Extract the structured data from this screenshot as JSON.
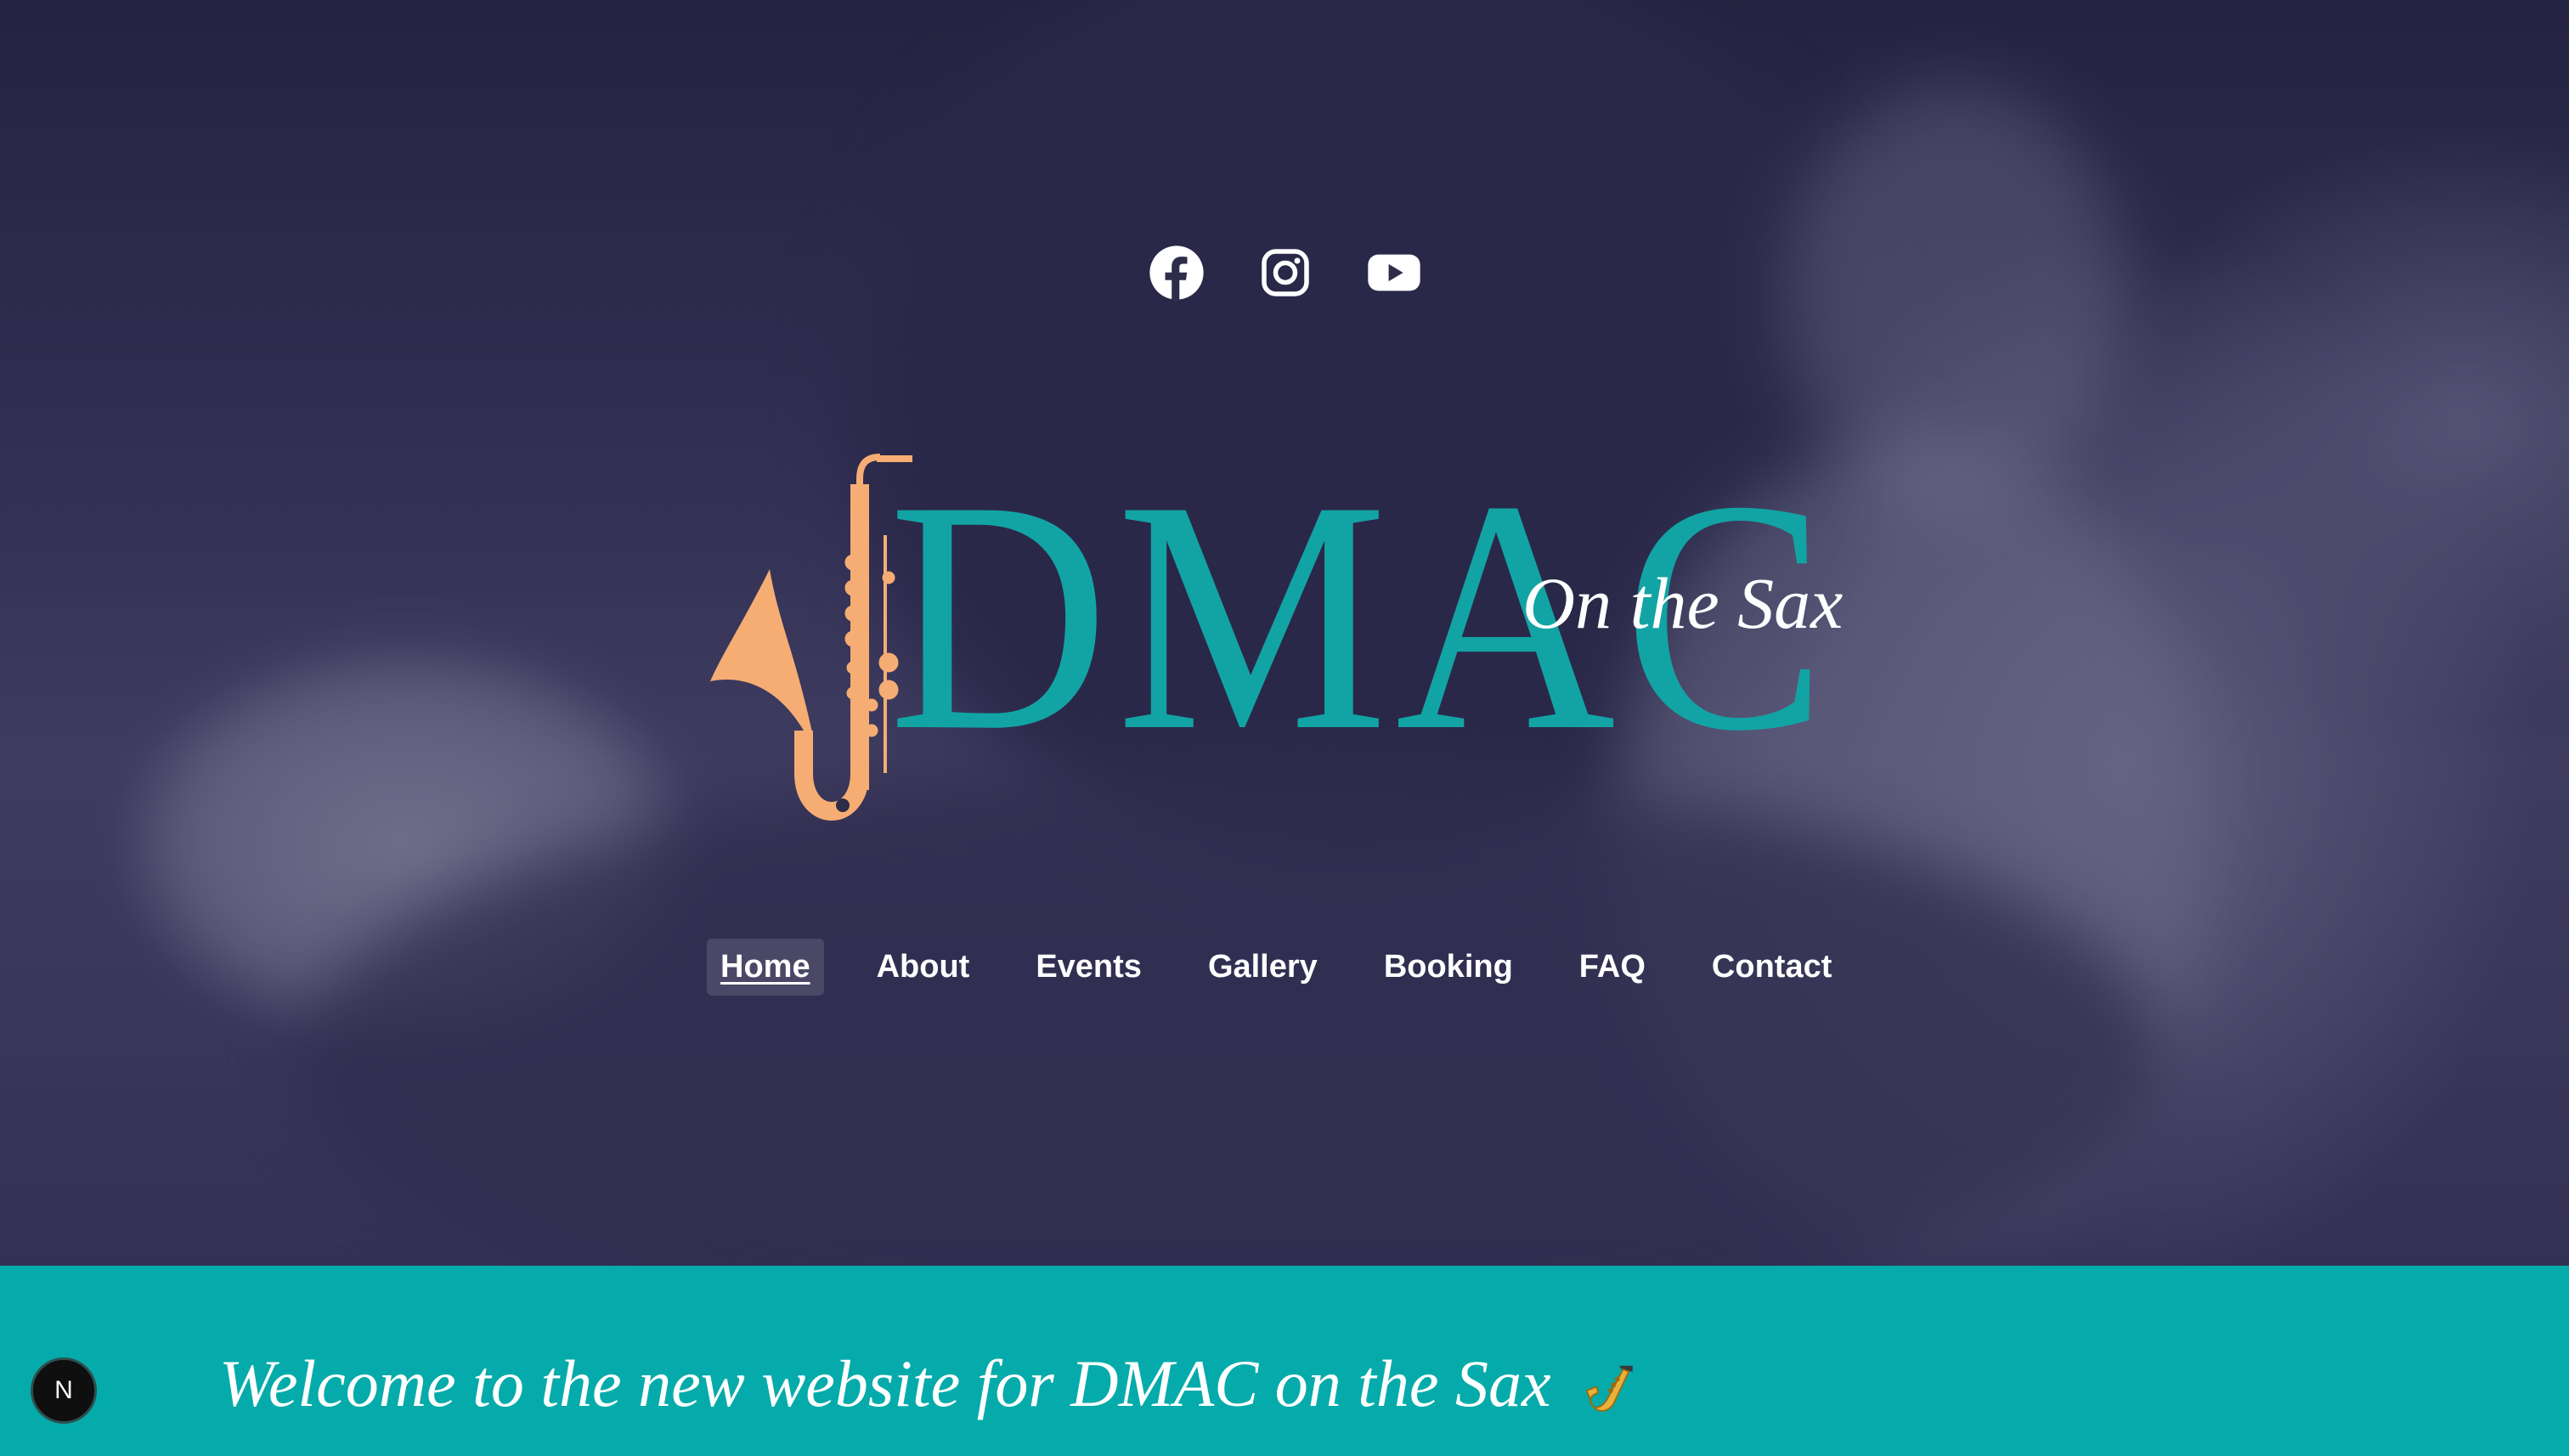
{
  "socials": [
    {
      "name": "Facebook",
      "icon": "facebook-icon"
    },
    {
      "name": "Instagram",
      "icon": "instagram-icon"
    },
    {
      "name": "YouTube",
      "icon": "youtube-icon"
    }
  ],
  "logo": {
    "wordmark": "DMAC",
    "tagline": "On the Sax",
    "icon": "saxophone-icon",
    "wordmark_color": "#12a4a4",
    "sax_color": "#f5ad74"
  },
  "nav": {
    "items": [
      "Home",
      "About",
      "Events",
      "Gallery",
      "Booking",
      "FAQ",
      "Contact"
    ],
    "active": "Home"
  },
  "banner": {
    "text": "Welcome to the new website for DMAC on the Sax",
    "emoji_icon": "saxophone-emoji-icon",
    "background": "#05abaa"
  },
  "dev_badge": {
    "label": "N",
    "icon": "nextjs-icon"
  }
}
